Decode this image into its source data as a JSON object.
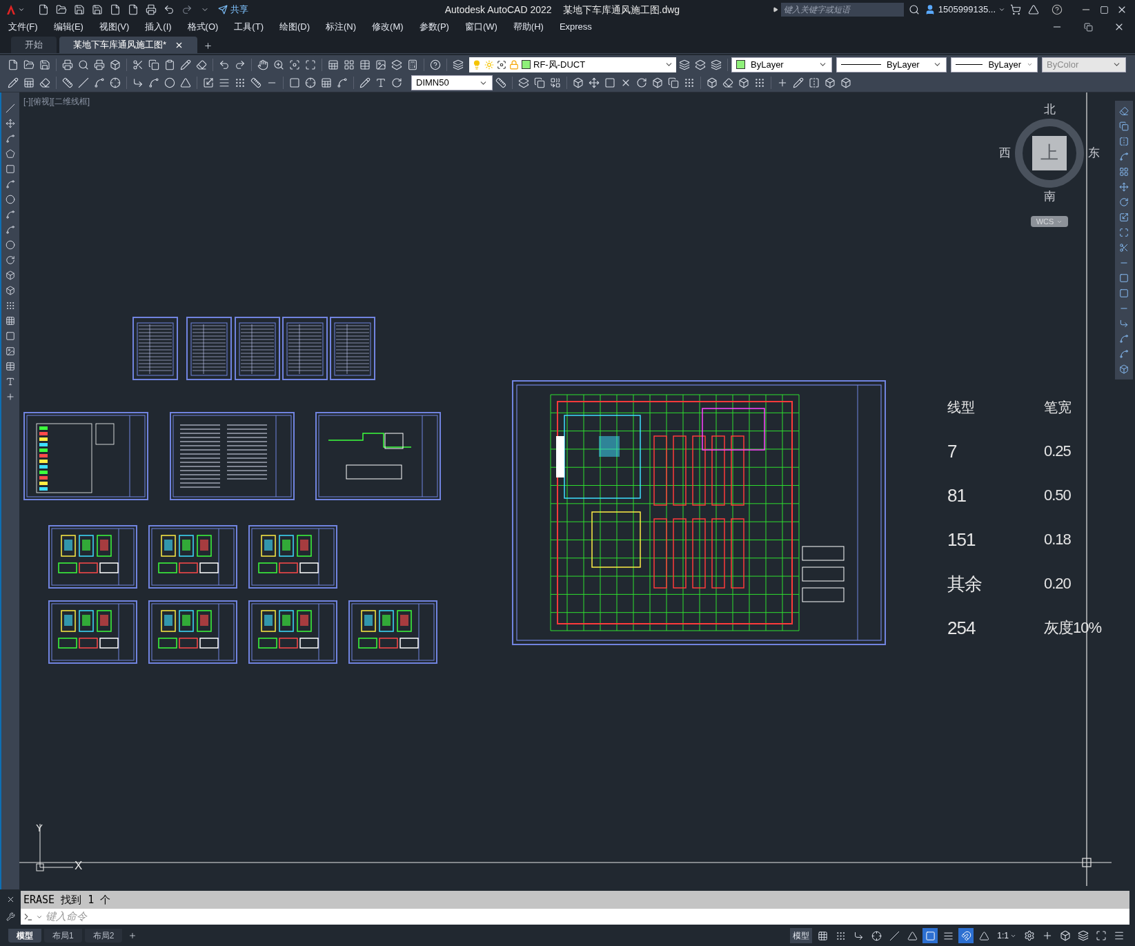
{
  "title_bar": {
    "app_title": "Autodesk AutoCAD 2022",
    "file_name": "某地下车库通风施工图.dwg",
    "share": "共享",
    "search": {
      "placeholder": "键入关键字或短语"
    },
    "user": "1505999135..."
  },
  "menu": [
    "文件(F)",
    "编辑(E)",
    "视图(V)",
    "插入(I)",
    "格式(O)",
    "工具(T)",
    "绘图(D)",
    "标注(N)",
    "修改(M)",
    "参数(P)",
    "窗口(W)",
    "帮助(H)",
    "Express"
  ],
  "doc_tabs": [
    {
      "label": "开始",
      "selected": false
    },
    {
      "label": "某地下车库通风施工图*",
      "selected": true
    }
  ],
  "layer_combo": {
    "value": "RF-风-DUCT",
    "color": "#8ff07a"
  },
  "color_combo": {
    "value": "ByLayer",
    "color": "#8ff07a"
  },
  "linetype_combo": {
    "value": "ByLayer"
  },
  "lineweight_combo": {
    "value": "ByLayer"
  },
  "plotstyle_combo": {
    "value": "ByColor",
    "disabled": true
  },
  "dimstyle_combo": {
    "value": "DIMN50"
  },
  "viewport_label": "[-][俯视][二维线框]",
  "viewcube": {
    "north": "北",
    "south": "南",
    "west": "西",
    "east": "东",
    "face": "上",
    "ucs": "WCS"
  },
  "legend": {
    "headers": [
      "线型",
      "笔宽"
    ],
    "rows": [
      [
        "7",
        "0.25"
      ],
      [
        "81",
        "0.50"
      ],
      [
        "151",
        "0.18"
      ],
      [
        "其余",
        "0.20"
      ],
      [
        "254",
        "灰度10%"
      ]
    ]
  },
  "axes": {
    "x": "X",
    "y": "Y"
  },
  "command_history": "ERASE 找到 1 个",
  "command_input": {
    "placeholder": "键入命令"
  },
  "layout_tabs": [
    {
      "label": "模型",
      "selected": true
    },
    {
      "label": "布局1",
      "selected": false
    },
    {
      "label": "布局2",
      "selected": false
    }
  ],
  "status_bar": {
    "model": "模型",
    "scale": "1:1",
    "toggles": [
      {
        "kind": "grid",
        "on": false
      },
      {
        "kind": "snap",
        "on": false
      },
      {
        "kind": "ortho",
        "on": false
      },
      {
        "kind": "polar",
        "on": false
      },
      {
        "kind": "isodraft",
        "on": false
      },
      {
        "kind": "angle",
        "on": false
      },
      {
        "kind": "osnap",
        "on": true
      },
      {
        "kind": "lineweight",
        "on": false
      },
      {
        "kind": "annovisible",
        "on": true
      },
      {
        "kind": "autoscale",
        "on": false
      }
    ]
  }
}
